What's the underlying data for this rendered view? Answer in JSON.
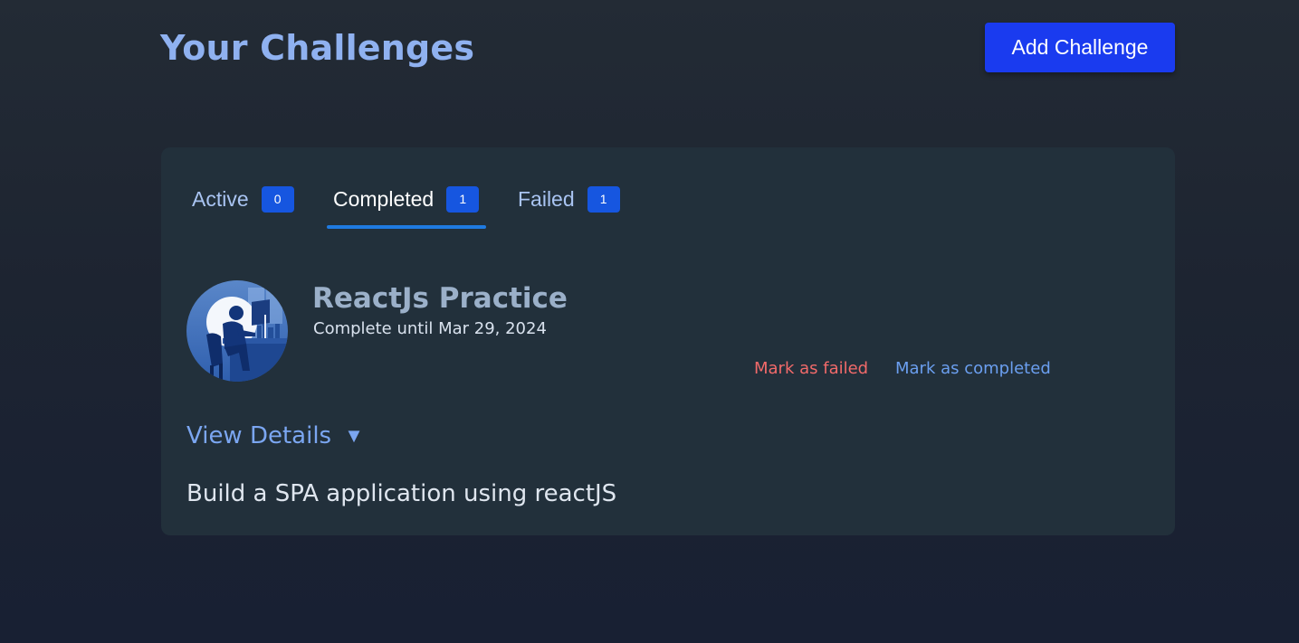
{
  "header": {
    "title": "Your Challenges",
    "add_button_label": "Add Challenge"
  },
  "tabs": [
    {
      "label": "Active",
      "count": "0",
      "selected": false
    },
    {
      "label": "Completed",
      "count": "1",
      "selected": true
    },
    {
      "label": "Failed",
      "count": "1",
      "selected": false
    }
  ],
  "challenge": {
    "image_icon": "person-at-computer-illustration",
    "title": "ReactJs Practice",
    "deadline_text": "Complete until Mar 29, 2024",
    "mark_failed_label": "Mark as failed",
    "mark_completed_label": "Mark as completed",
    "details_toggle_label": "View Details",
    "details_toggle_icon": "▼",
    "description": "Build a SPA application using reactJS"
  },
  "colors": {
    "accent": "#1a3bef",
    "badge": "#1656e0",
    "tab_underline": "#1f7ae0",
    "fail_link": "#f26a6a",
    "complete_link": "#6b9ff0",
    "title": "#8fb1f0"
  }
}
